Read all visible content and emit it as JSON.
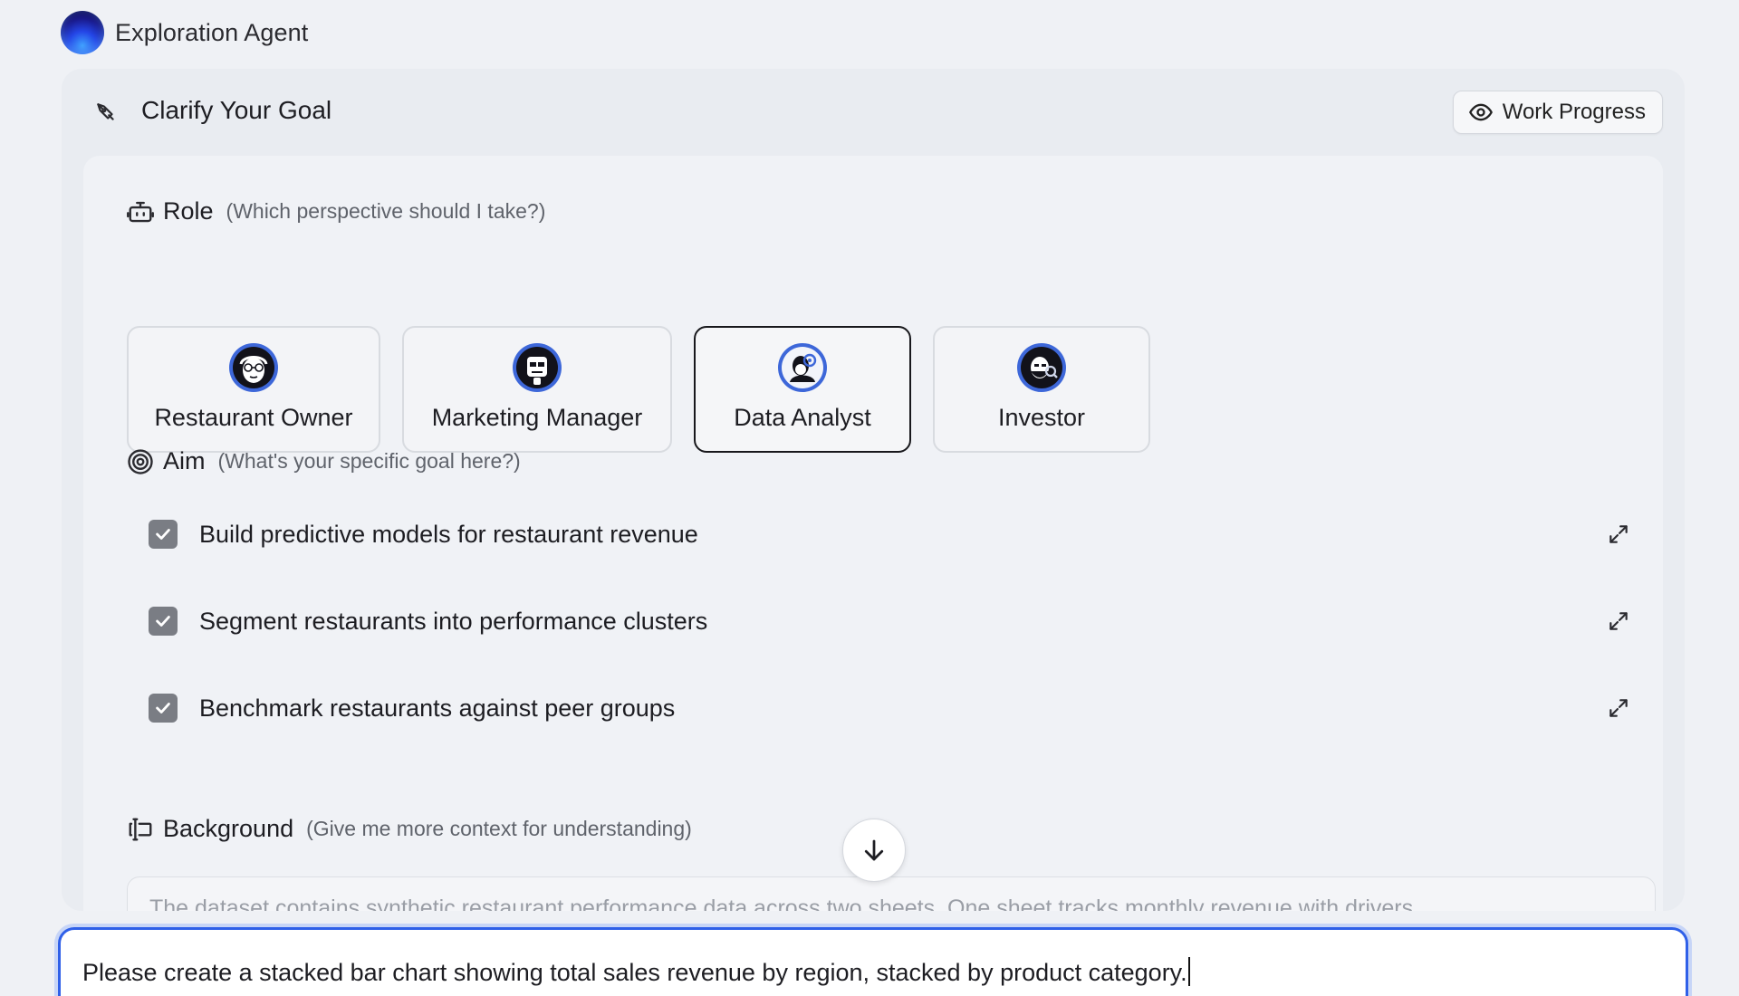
{
  "app": {
    "title": "Exploration Agent"
  },
  "panel": {
    "title": "Clarify Your Goal",
    "work_progress_label": "Work Progress"
  },
  "role": {
    "name": "Role",
    "hint": "(Which perspective should I take?)",
    "options": [
      {
        "label": "Restaurant Owner",
        "selected": false
      },
      {
        "label": "Marketing Manager",
        "selected": false
      },
      {
        "label": "Data Analyst",
        "selected": true
      },
      {
        "label": "Investor",
        "selected": false
      }
    ]
  },
  "aim": {
    "name": "Aim",
    "hint": "(What's your specific goal here?)",
    "items": [
      {
        "label": "Build predictive models for restaurant revenue",
        "checked": true
      },
      {
        "label": "Segment restaurants into performance clusters",
        "checked": true
      },
      {
        "label": "Benchmark restaurants against peer groups",
        "checked": true
      }
    ]
  },
  "background": {
    "name": "Background",
    "hint": "(Give me more context for understanding)",
    "text": "The dataset contains synthetic restaurant performance data across two sheets. One sheet tracks monthly revenue with drivers"
  },
  "composer": {
    "value": "Please create a stacked bar chart showing total sales revenue by region, stacked by product category."
  },
  "colors": {
    "accent": "#2f60e8",
    "checkbox": "#7a7d84",
    "selected_border": "#18181c"
  }
}
